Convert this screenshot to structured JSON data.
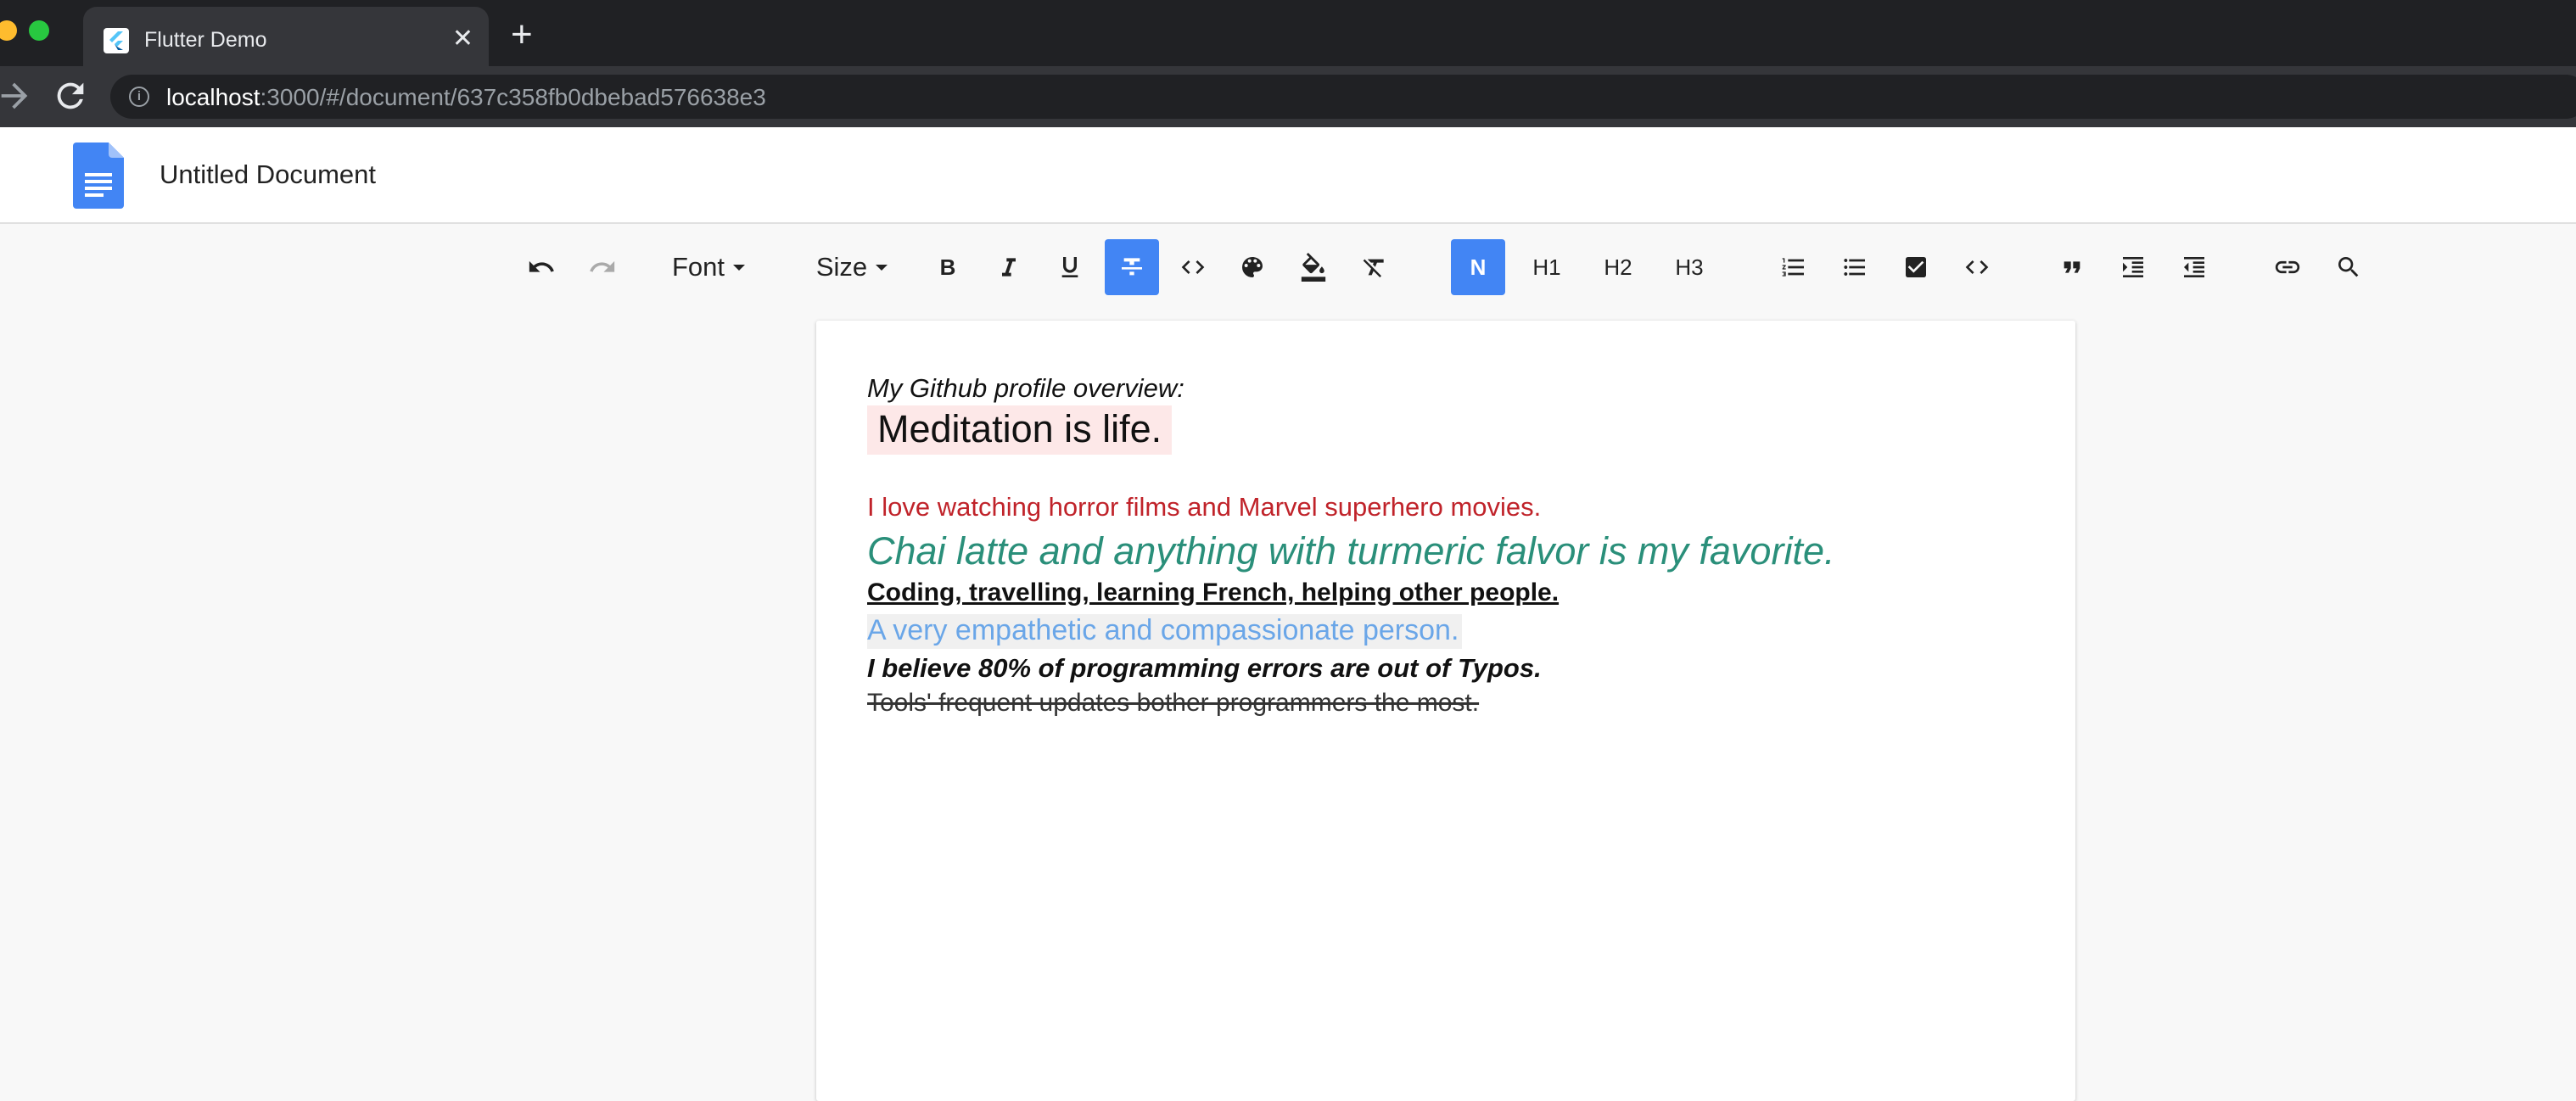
{
  "browser": {
    "tab_title": "Flutter Demo",
    "tab_close": "✕",
    "new_tab": "+",
    "url_host": "localhost",
    "url_path": ":3000/#/document/637c358fb0dbebad576638e3"
  },
  "app": {
    "document_title": "Untitled Document",
    "brand_color": "#4285f4"
  },
  "toolbar": {
    "font_label": "Font",
    "size_label": "Size",
    "bold": "B",
    "normal": "N",
    "h1": "H1",
    "h2": "H2",
    "h3": "H3",
    "active_buttons": [
      "strikethrough",
      "normal"
    ]
  },
  "document": {
    "lines": [
      "My Github profile overview:",
      "Meditation is life.",
      "I love watching horror films and Marvel superhero movies.",
      "Chai latte and anything with turmeric falvor is my favorite.",
      "Coding, travelling, learning French, helping other people.",
      "A very empathetic and compassionate person.",
      "I believe 80% of programming errors are out of Typos.",
      "Tools' frequent updates bother programmers the most."
    ],
    "colors": {
      "red_text": "#c0232a",
      "teal_text": "#2a8f7a",
      "blue_text": "#6aa6e8",
      "highlight_pink": "#fde8e8"
    }
  }
}
